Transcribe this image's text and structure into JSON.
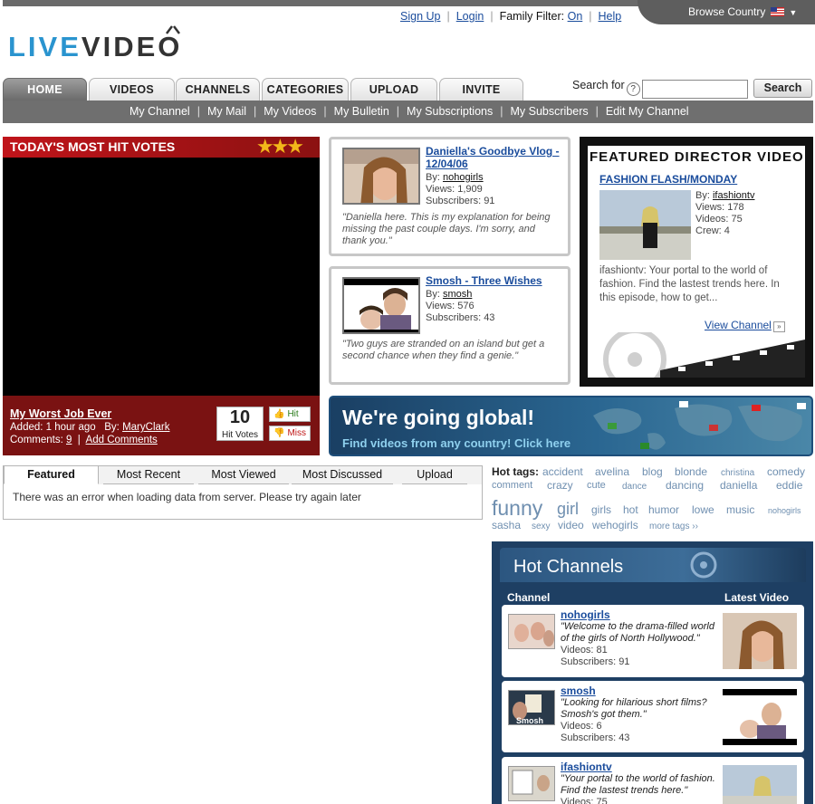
{
  "header": {
    "links": {
      "signup": "Sign Up",
      "login": "Login",
      "family_filter_label": "Family Filter:",
      "family_filter_value": "On",
      "help": "Help"
    },
    "browse_country": "Browse Country",
    "logo": {
      "part1": "LIVE",
      "part2": "VIDEO"
    }
  },
  "nav": {
    "tabs": [
      "HOME",
      "VIDEOS",
      "CHANNELS",
      "CATEGORIES",
      "UPLOAD",
      "INVITE"
    ],
    "search_label": "Search for",
    "search_button": "Search",
    "subnav": [
      "My Channel",
      "My Mail",
      "My Videos",
      "My Bulletin",
      "My Subscriptions",
      "My Subscribers",
      "Edit My Channel"
    ]
  },
  "hit_votes": {
    "heading": "TODAY'S MOST HIT VOTES",
    "title": "My Worst Job Ever",
    "added_label": "Added:",
    "added_value": "1 hour ago",
    "by_label": "By:",
    "by_user": "MaryClark",
    "comments_label": "Comments:",
    "comments_count": "9",
    "add_comments": "Add Comments",
    "votes": "10",
    "votes_label": "Hit Votes",
    "hit": "Hit",
    "miss": "Miss"
  },
  "videos": [
    {
      "title": "Daniella's Goodbye Vlog - 12/04/06",
      "by_label": "By:",
      "by": "nohogirls",
      "views": "Views: 1,909",
      "subscribers": "Subscribers: 91",
      "desc": "\"Daniella here. This is my explanation for being missing the past couple days. I'm sorry, and thank you.\""
    },
    {
      "title": "Smosh - Three Wishes",
      "by_label": "By:",
      "by": "smosh",
      "views": "Views: 576",
      "subscribers": "Subscribers: 43",
      "desc": "\"Two guys are stranded on an island but get a second chance when they find a genie.\""
    }
  ],
  "featured": {
    "heading": "FEATURED DIRECTOR VIDEO",
    "video_title": "FASHION FLASH/MONDAY",
    "by_label": "By:",
    "by": "ifashiontv",
    "views": "Views: 178",
    "videos": "Videos: 75",
    "crew": "Crew: 4",
    "desc": "ifashiontv: Your portal to the world of fashion. Find the lastest trends here. In this episode, how to get...",
    "view_channel": "View Channel"
  },
  "global_banner": {
    "headline": "We're going global!",
    "sub": "Find videos from any country!  Click here"
  },
  "video_tabs": {
    "tabs": [
      "Featured",
      "Most Recent",
      "Most Viewed",
      "Most Discussed",
      "Upload"
    ],
    "error": "There was an error when loading data from server. Please try again later"
  },
  "hot_tags": {
    "label": "Hot tags:",
    "tags": [
      "accident",
      "avelina",
      "blog",
      "blonde",
      "christina",
      "comedy",
      "comment",
      "crazy",
      "cute",
      "dance",
      "dancing",
      "daniella",
      "eddie",
      "funny",
      "girl",
      "girls",
      "hot",
      "humor",
      "lowe",
      "music",
      "nohogirls",
      "sasha",
      "sexy",
      "video",
      "wehogirls"
    ],
    "more": "more tags ››"
  },
  "hot_channels": {
    "title": "Hot Channels",
    "col_channel": "Channel",
    "col_latest": "Latest Video",
    "rows": [
      {
        "name": "nohogirls",
        "quote": "\"Welcome to the drama-filled world of the girls of North Hollywood.\"",
        "videos": "Videos: 81",
        "subscribers": "Subscribers: 91"
      },
      {
        "name": "smosh",
        "quote": "\"Looking for hilarious short films? Smosh's got them.\"",
        "videos": "Videos: 6",
        "subscribers": "Subscribers: 43"
      },
      {
        "name": "ifashiontv",
        "quote": "\"Your portal to the world of fashion. Find the lastest trends here.\"",
        "videos": "Videos: 75",
        "subscribers": ""
      }
    ]
  },
  "colors": {
    "brand_blue": "#2a94cf",
    "nav_gray": "#6f6f6f",
    "hit_red": "#7a1212",
    "channel_navy": "#1e3f63",
    "link": "#1a4c9c"
  }
}
